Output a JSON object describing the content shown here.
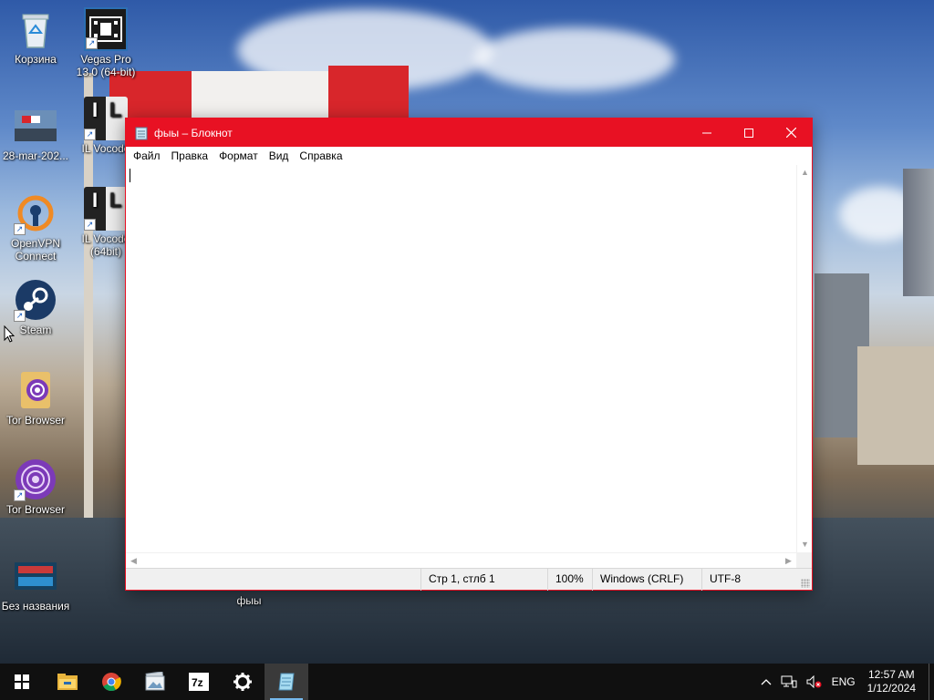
{
  "desktop": {
    "icons": [
      {
        "label": "Корзина",
        "icon": "recycle-bin-icon"
      },
      {
        "label": "Vegas Pro 13.0 (64-bit)",
        "icon": "film-icon"
      },
      {
        "label": "28-mar-202...",
        "icon": "image-icon"
      },
      {
        "label": "IL Vocode",
        "icon": "il-vocoder-icon"
      },
      {
        "label": "OpenVPN Connect",
        "icon": "openvpn-icon"
      },
      {
        "label": "IL Vocode (64bit)",
        "icon": "il-vocoder-icon"
      },
      {
        "label": "Steam",
        "icon": "steam-icon"
      },
      {
        "label": "Tor Browser",
        "icon": "tor-folder-icon"
      },
      {
        "label": "Tor Browser",
        "icon": "tor-browser-icon"
      },
      {
        "label": "Без названия",
        "icon": "image-icon"
      },
      {
        "label": "фыы",
        "icon": "text-file-icon"
      }
    ]
  },
  "notepad": {
    "title": "фыы – Блокнот",
    "menu": [
      "Файл",
      "Правка",
      "Формат",
      "Вид",
      "Справка"
    ],
    "content": "",
    "status": {
      "position": "Стр 1, стлб 1",
      "zoom": "100%",
      "line_endings": "Windows (CRLF)",
      "encoding": "UTF-8"
    },
    "accent_color": "#e81123"
  },
  "taskbar": {
    "apps": [
      "start-icon",
      "file-explorer-icon",
      "chrome-icon",
      "photos-icon",
      "7zip-icon",
      "settings-icon",
      "notepad-icon"
    ],
    "tray": {
      "language": "ENG",
      "time": "12:57 AM",
      "date": "1/12/2024"
    }
  }
}
